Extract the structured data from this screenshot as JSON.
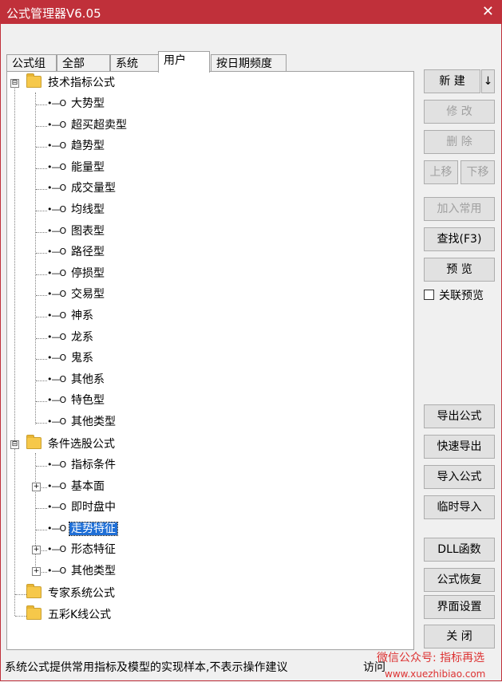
{
  "window": {
    "title": "公式管理器V6.05",
    "close_label": "✕"
  },
  "tabs": [
    {
      "label": "公式组"
    },
    {
      "label": "全部"
    },
    {
      "label": "系统"
    },
    {
      "label": "用户"
    },
    {
      "label": "按日期频度"
    }
  ],
  "active_tab": "用户",
  "tree": {
    "groups": [
      {
        "label": "技术指标公式",
        "expander": "⊟",
        "items": [
          "大势型",
          "超买超卖型",
          "趋势型",
          "能量型",
          "成交量型",
          "均线型",
          "图表型",
          "路径型",
          "停损型",
          "交易型",
          "神系",
          "龙系",
          "鬼系",
          "其他系",
          "特色型",
          "其他类型"
        ]
      },
      {
        "label": "条件选股公式",
        "expander": "⊟",
        "items": [
          "指标条件",
          "基本面",
          "即时盘中",
          "走势特征",
          "形态特征",
          "其他类型"
        ],
        "expandable_items": [
          "基本面",
          "形态特征",
          "其他类型"
        ],
        "selected_item": "走势特征"
      },
      {
        "label": "专家系统公式"
      },
      {
        "label": "五彩K线公式"
      }
    ]
  },
  "buttons": {
    "new": "新 建",
    "new_arrow": "↓",
    "modify": "修 改",
    "delete": "删 除",
    "move_up": "上移",
    "move_down": "下移",
    "add_common": "加入常用",
    "find": "查找(F3)",
    "preview": "预 览",
    "linked_preview": "关联预览",
    "export_formula": "导出公式",
    "quick_export": "快速导出",
    "import_formula": "导入公式",
    "temp_import": "临时导入",
    "dll_func": "DLL函数",
    "restore_formula": "公式恢复",
    "ui_settings": "界面设置",
    "close": "关 闭"
  },
  "status_bar": {
    "text": "系统公式提供常用指标及模型的实现样本,不表示操作建议",
    "text2": "访问"
  },
  "watermark": {
    "line1": "微信公众号: 指标再选",
    "line2": "www.xuezhibiao.com",
    "color": "#dd3333"
  }
}
